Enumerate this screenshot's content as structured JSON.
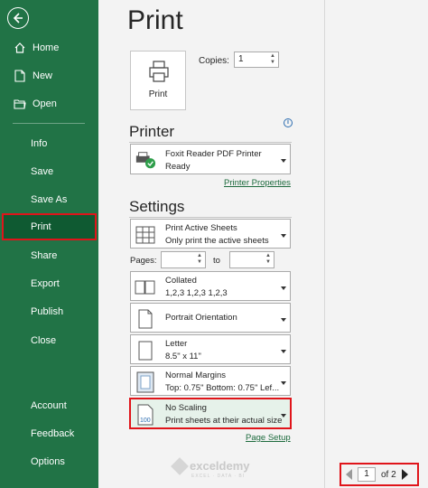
{
  "sidebar": {
    "items": [
      {
        "label": "Home",
        "icon": "home-icon"
      },
      {
        "label": "New",
        "icon": "new-document-icon"
      },
      {
        "label": "Open",
        "icon": "open-folder-icon"
      },
      {
        "label": "Info"
      },
      {
        "label": "Save"
      },
      {
        "label": "Save As"
      },
      {
        "label": "Print"
      },
      {
        "label": "Share"
      },
      {
        "label": "Export"
      },
      {
        "label": "Publish"
      },
      {
        "label": "Close"
      },
      {
        "label": "Account"
      },
      {
        "label": "Feedback"
      },
      {
        "label": "Options"
      }
    ],
    "active": "Print",
    "bg_color": "#217346",
    "highlight_color": "#e0141a"
  },
  "main": {
    "title": "Print",
    "print_button_label": "Print",
    "copies_label": "Copies:",
    "copies_value": "1",
    "printer": {
      "section_title": "Printer",
      "name": "Foxit Reader PDF Printer",
      "status": "Ready",
      "properties_link": "Printer Properties"
    },
    "settings": {
      "section_title": "Settings",
      "what": {
        "line1": "Print Active Sheets",
        "line2": "Only print the active sheets"
      },
      "pages_label": "Pages:",
      "to_label": "to",
      "pages_from": "",
      "pages_to": "",
      "collate": {
        "line1": "Collated",
        "line2": "1,2,3    1,2,3    1,2,3"
      },
      "orientation": {
        "line1": "Portrait Orientation"
      },
      "paper": {
        "line1": "Letter",
        "line2": "8.5\" x 11\""
      },
      "margins": {
        "line1": "Normal Margins",
        "line2": "Top: 0.75\" Bottom: 0.75\" Lef..."
      },
      "scaling": {
        "line1": "No Scaling",
        "line2": "Print sheets at their actual size"
      },
      "page_setup_link": "Page Setup"
    },
    "preview": {
      "current_page": "1",
      "of_pages": "of 2",
      "watermark_name": "exceldemy",
      "watermark_sub": "EXCEL · DATA · BI"
    }
  }
}
